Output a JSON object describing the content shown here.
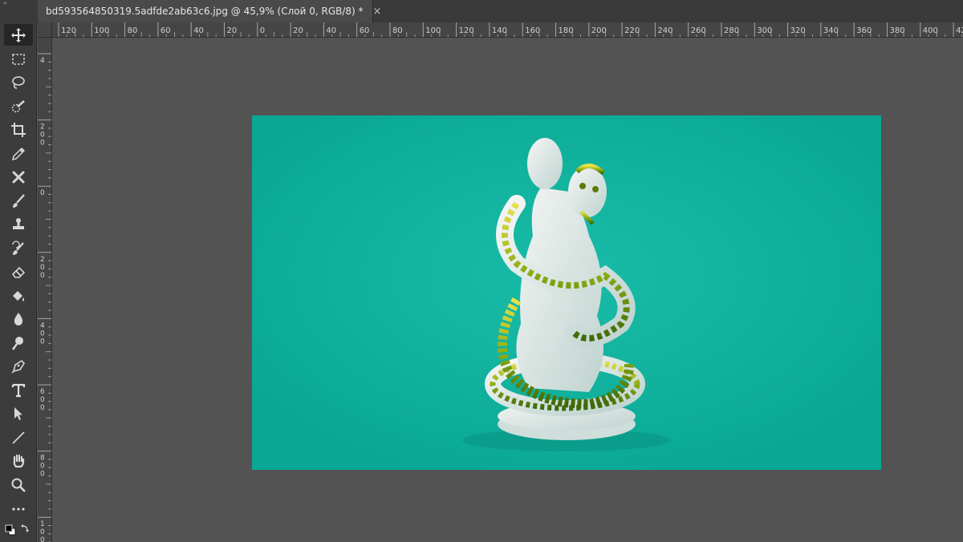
{
  "document": {
    "tab_title": "bd593564850319.5adfde2ab63c6.jpg @ 45,9% (Слой 0, RGB/8) *",
    "close_glyph": "×"
  },
  "panel_expander": "»",
  "rulers": {
    "horizontal_labels": [
      "120",
      "100",
      "80",
      "60",
      "40",
      "20",
      "0",
      "20",
      "40",
      "60",
      "80",
      "100",
      "120",
      "140",
      "160",
      "180",
      "200",
      "220",
      "240",
      "260",
      "280",
      "300",
      "320",
      "340",
      "360",
      "380",
      "400",
      "42"
    ],
    "vertical_labels": [
      "4",
      "2",
      "0",
      "2",
      "4",
      "6",
      "8",
      "1"
    ]
  },
  "tools": [
    {
      "name": "move-tool-icon",
      "glyph": "✥"
    },
    {
      "name": "rectangular-marquee-tool-icon",
      "glyph": "⬚"
    },
    {
      "name": "lasso-tool-icon",
      "glyph": "ℓ"
    },
    {
      "name": "quick-selection-tool-icon",
      "glyph": "✎"
    },
    {
      "name": "crop-tool-icon",
      "glyph": "⌗"
    },
    {
      "name": "eyedropper-tool-icon",
      "glyph": "✒"
    },
    {
      "name": "healing-brush-tool-icon",
      "glyph": "✂"
    },
    {
      "name": "brush-tool-icon",
      "glyph": "✏"
    },
    {
      "name": "clone-stamp-tool-icon",
      "glyph": "⊥"
    },
    {
      "name": "history-brush-tool-icon",
      "glyph": "⤺"
    },
    {
      "name": "eraser-tool-icon",
      "glyph": "⌫"
    },
    {
      "name": "paint-bucket-tool-icon",
      "glyph": "◈"
    },
    {
      "name": "blur-tool-icon",
      "glyph": "💧"
    },
    {
      "name": "dodge-tool-icon",
      "glyph": "⚲"
    },
    {
      "name": "pen-tool-icon",
      "glyph": "✒"
    },
    {
      "name": "type-tool-icon",
      "glyph": "T"
    },
    {
      "name": "path-selection-tool-icon",
      "glyph": "➤"
    },
    {
      "name": "line-tool-icon",
      "glyph": "╱"
    },
    {
      "name": "hand-tool-icon",
      "glyph": "✋"
    },
    {
      "name": "zoom-tool-icon",
      "glyph": "🔍"
    },
    {
      "name": "edit-toolbar-icon",
      "glyph": "•••"
    }
  ],
  "colors": {
    "canvas_background": "#0fb09d",
    "workspace": "#535353",
    "toolbar": "#3c3c3c"
  }
}
